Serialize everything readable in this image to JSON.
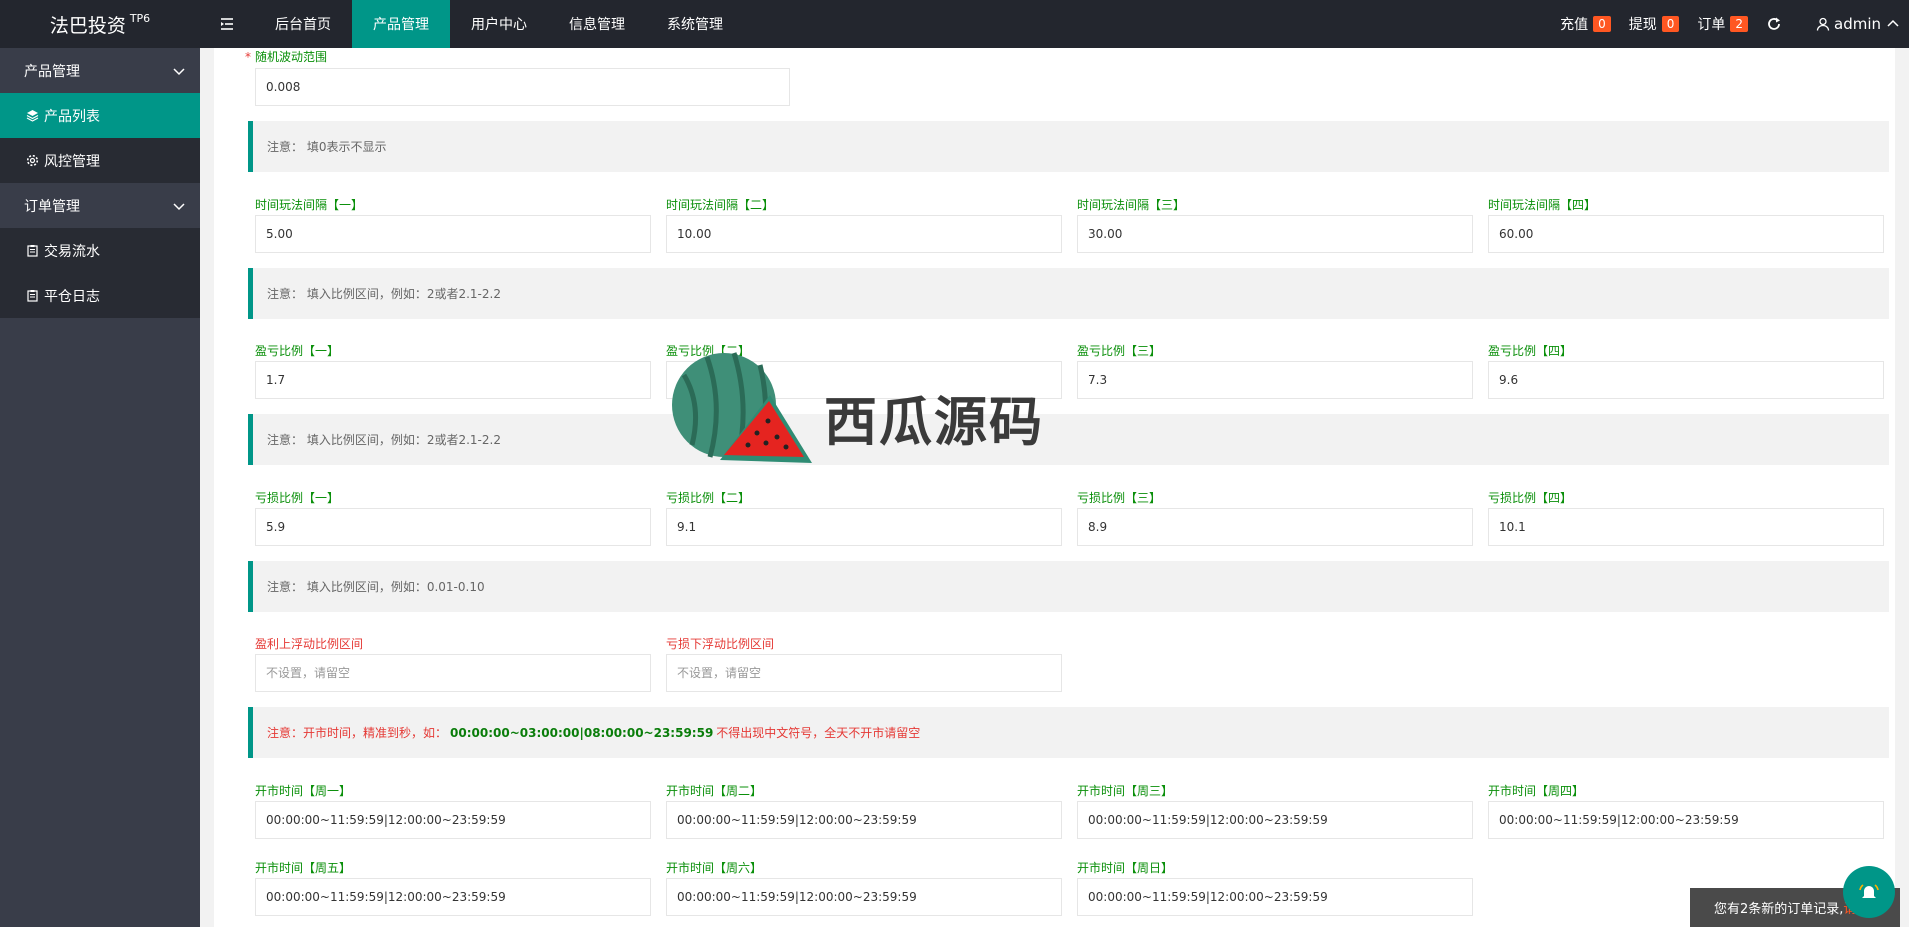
{
  "brand": {
    "name": "法巴投资",
    "sup": "TP6"
  },
  "topnav": [
    "后台首页",
    "产品管理",
    "用户中心",
    "信息管理",
    "系统管理"
  ],
  "header_right": {
    "recharge": {
      "label": "充值",
      "count": "0"
    },
    "withdraw": {
      "label": "提现",
      "count": "0"
    },
    "orders": {
      "label": "订单",
      "count": "2"
    },
    "user": "admin"
  },
  "sidebar": {
    "group_product": "产品管理",
    "product_list": "产品列表",
    "risk": "风控管理",
    "group_order": "订单管理",
    "trade_flow": "交易流水",
    "close_log": "平仓日志"
  },
  "form": {
    "random_range": {
      "label": "随机波动范围",
      "value": "0.008"
    },
    "note_zero": "注意：  填0表示不显示",
    "interval": {
      "labels": [
        "时间玩法间隔【一】",
        "时间玩法间隔【二】",
        "时间玩法间隔【三】",
        "时间玩法间隔【四】"
      ],
      "values": [
        "5.00",
        "10.00",
        "30.00",
        "60.00"
      ]
    },
    "note_ratio": "注意：  填入比例区间，例如：2或者2.1-2.2",
    "profit": {
      "labels": [
        "盈亏比例【一】",
        "盈亏比例【二】",
        "盈亏比例【三】",
        "盈亏比例【四】"
      ],
      "values": [
        "1.7",
        "",
        "7.3",
        "9.6"
      ]
    },
    "note_ratio2": "注意：  填入比例区间，例如：2或者2.1-2.2",
    "loss": {
      "labels": [
        "亏损比例【一】",
        "亏损比例【二】",
        "亏损比例【三】",
        "亏损比例【四】"
      ],
      "values": [
        "5.9",
        "9.1",
        "8.9",
        "10.1"
      ]
    },
    "note_float": "注意：  填入比例区间，例如：0.01-0.10",
    "float": {
      "labels": [
        "盈利上浮动比例区间",
        "亏损下浮动比例区间"
      ],
      "placeholder": "不设置，请留空"
    },
    "note_time": {
      "prefix": "注意：开市时间，精准到秒，如：",
      "example": "00:00:00~03:00:00|08:00:00~23:59:59",
      "suffix": "不得出现中文符号，全天不开市请留空"
    },
    "open": {
      "labels": [
        "开市时间【周一】",
        "开市时间【周二】",
        "开市时间【周三】",
        "开市时间【周四】",
        "开市时间【周五】",
        "开市时间【周六】",
        "开市时间【周日】"
      ],
      "values": [
        "00:00:00~11:59:59|12:00:00~23:59:59",
        "00:00:00~11:59:59|12:00:00~23:59:59",
        "00:00:00~11:59:59|12:00:00~23:59:59",
        "00:00:00~11:59:59|12:00:00~23:59:59",
        "00:00:00~11:59:59|12:00:00~23:59:59",
        "00:00:00~11:59:59|12:00:00~23:59:59",
        "00:00:00~11:59:59|12:00:00~23:59:59"
      ]
    }
  },
  "watermark": "西瓜源码",
  "notification": {
    "text": "您有2条新的订单记录,",
    "link": "请查看"
  },
  "colors": {
    "accent": "#009688",
    "header_bg": "#23262e",
    "sidebar_bg": "#393d49",
    "badge": "#ff5722"
  }
}
